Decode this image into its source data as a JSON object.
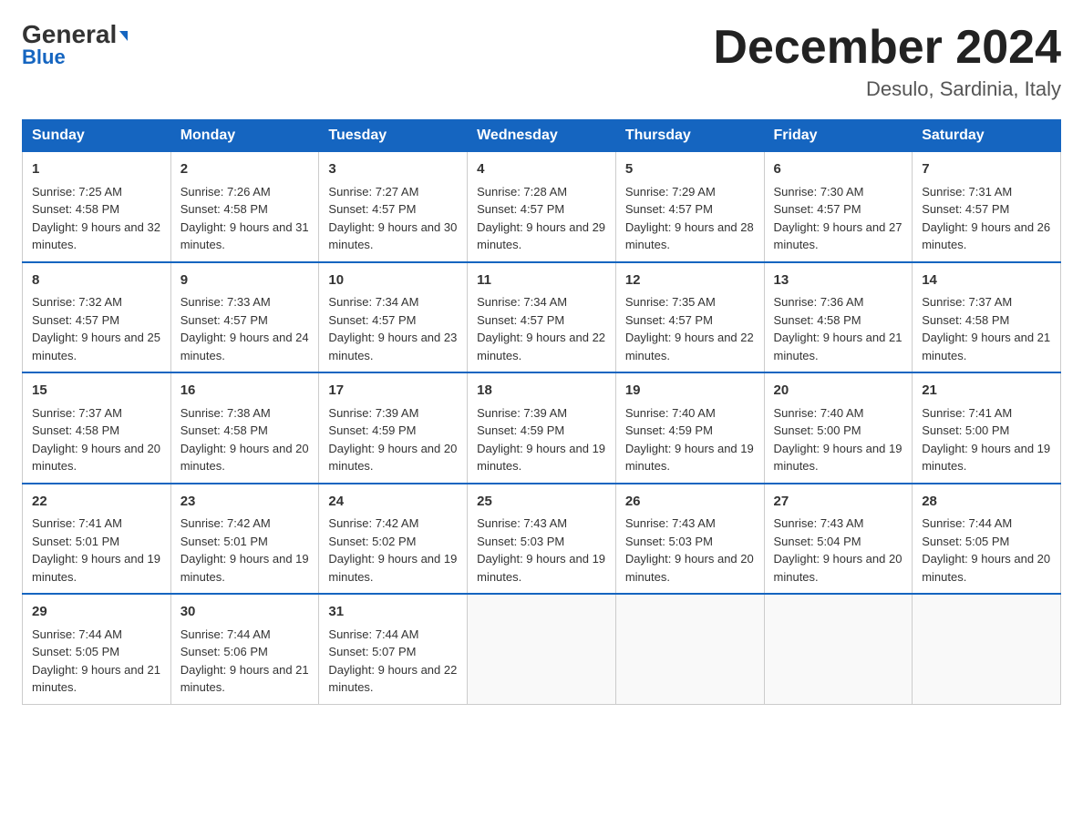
{
  "header": {
    "logo_top": "General",
    "logo_arrow": "▶",
    "logo_bottom": "Blue",
    "title": "December 2024",
    "subtitle": "Desulo, Sardinia, Italy"
  },
  "weekdays": [
    "Sunday",
    "Monday",
    "Tuesday",
    "Wednesday",
    "Thursday",
    "Friday",
    "Saturday"
  ],
  "weeks": [
    [
      {
        "day": "1",
        "sunrise": "7:25 AM",
        "sunset": "4:58 PM",
        "daylight": "9 hours and 32 minutes."
      },
      {
        "day": "2",
        "sunrise": "7:26 AM",
        "sunset": "4:58 PM",
        "daylight": "9 hours and 31 minutes."
      },
      {
        "day": "3",
        "sunrise": "7:27 AM",
        "sunset": "4:57 PM",
        "daylight": "9 hours and 30 minutes."
      },
      {
        "day": "4",
        "sunrise": "7:28 AM",
        "sunset": "4:57 PM",
        "daylight": "9 hours and 29 minutes."
      },
      {
        "day": "5",
        "sunrise": "7:29 AM",
        "sunset": "4:57 PM",
        "daylight": "9 hours and 28 minutes."
      },
      {
        "day": "6",
        "sunrise": "7:30 AM",
        "sunset": "4:57 PM",
        "daylight": "9 hours and 27 minutes."
      },
      {
        "day": "7",
        "sunrise": "7:31 AM",
        "sunset": "4:57 PM",
        "daylight": "9 hours and 26 minutes."
      }
    ],
    [
      {
        "day": "8",
        "sunrise": "7:32 AM",
        "sunset": "4:57 PM",
        "daylight": "9 hours and 25 minutes."
      },
      {
        "day": "9",
        "sunrise": "7:33 AM",
        "sunset": "4:57 PM",
        "daylight": "9 hours and 24 minutes."
      },
      {
        "day": "10",
        "sunrise": "7:34 AM",
        "sunset": "4:57 PM",
        "daylight": "9 hours and 23 minutes."
      },
      {
        "day": "11",
        "sunrise": "7:34 AM",
        "sunset": "4:57 PM",
        "daylight": "9 hours and 22 minutes."
      },
      {
        "day": "12",
        "sunrise": "7:35 AM",
        "sunset": "4:57 PM",
        "daylight": "9 hours and 22 minutes."
      },
      {
        "day": "13",
        "sunrise": "7:36 AM",
        "sunset": "4:58 PM",
        "daylight": "9 hours and 21 minutes."
      },
      {
        "day": "14",
        "sunrise": "7:37 AM",
        "sunset": "4:58 PM",
        "daylight": "9 hours and 21 minutes."
      }
    ],
    [
      {
        "day": "15",
        "sunrise": "7:37 AM",
        "sunset": "4:58 PM",
        "daylight": "9 hours and 20 minutes."
      },
      {
        "day": "16",
        "sunrise": "7:38 AM",
        "sunset": "4:58 PM",
        "daylight": "9 hours and 20 minutes."
      },
      {
        "day": "17",
        "sunrise": "7:39 AM",
        "sunset": "4:59 PM",
        "daylight": "9 hours and 20 minutes."
      },
      {
        "day": "18",
        "sunrise": "7:39 AM",
        "sunset": "4:59 PM",
        "daylight": "9 hours and 19 minutes."
      },
      {
        "day": "19",
        "sunrise": "7:40 AM",
        "sunset": "4:59 PM",
        "daylight": "9 hours and 19 minutes."
      },
      {
        "day": "20",
        "sunrise": "7:40 AM",
        "sunset": "5:00 PM",
        "daylight": "9 hours and 19 minutes."
      },
      {
        "day": "21",
        "sunrise": "7:41 AM",
        "sunset": "5:00 PM",
        "daylight": "9 hours and 19 minutes."
      }
    ],
    [
      {
        "day": "22",
        "sunrise": "7:41 AM",
        "sunset": "5:01 PM",
        "daylight": "9 hours and 19 minutes."
      },
      {
        "day": "23",
        "sunrise": "7:42 AM",
        "sunset": "5:01 PM",
        "daylight": "9 hours and 19 minutes."
      },
      {
        "day": "24",
        "sunrise": "7:42 AM",
        "sunset": "5:02 PM",
        "daylight": "9 hours and 19 minutes."
      },
      {
        "day": "25",
        "sunrise": "7:43 AM",
        "sunset": "5:03 PM",
        "daylight": "9 hours and 19 minutes."
      },
      {
        "day": "26",
        "sunrise": "7:43 AM",
        "sunset": "5:03 PM",
        "daylight": "9 hours and 20 minutes."
      },
      {
        "day": "27",
        "sunrise": "7:43 AM",
        "sunset": "5:04 PM",
        "daylight": "9 hours and 20 minutes."
      },
      {
        "day": "28",
        "sunrise": "7:44 AM",
        "sunset": "5:05 PM",
        "daylight": "9 hours and 20 minutes."
      }
    ],
    [
      {
        "day": "29",
        "sunrise": "7:44 AM",
        "sunset": "5:05 PM",
        "daylight": "9 hours and 21 minutes."
      },
      {
        "day": "30",
        "sunrise": "7:44 AM",
        "sunset": "5:06 PM",
        "daylight": "9 hours and 21 minutes."
      },
      {
        "day": "31",
        "sunrise": "7:44 AM",
        "sunset": "5:07 PM",
        "daylight": "9 hours and 22 minutes."
      },
      null,
      null,
      null,
      null
    ]
  ],
  "cell_labels": {
    "sunrise": "Sunrise:",
    "sunset": "Sunset:",
    "daylight": "Daylight:"
  }
}
